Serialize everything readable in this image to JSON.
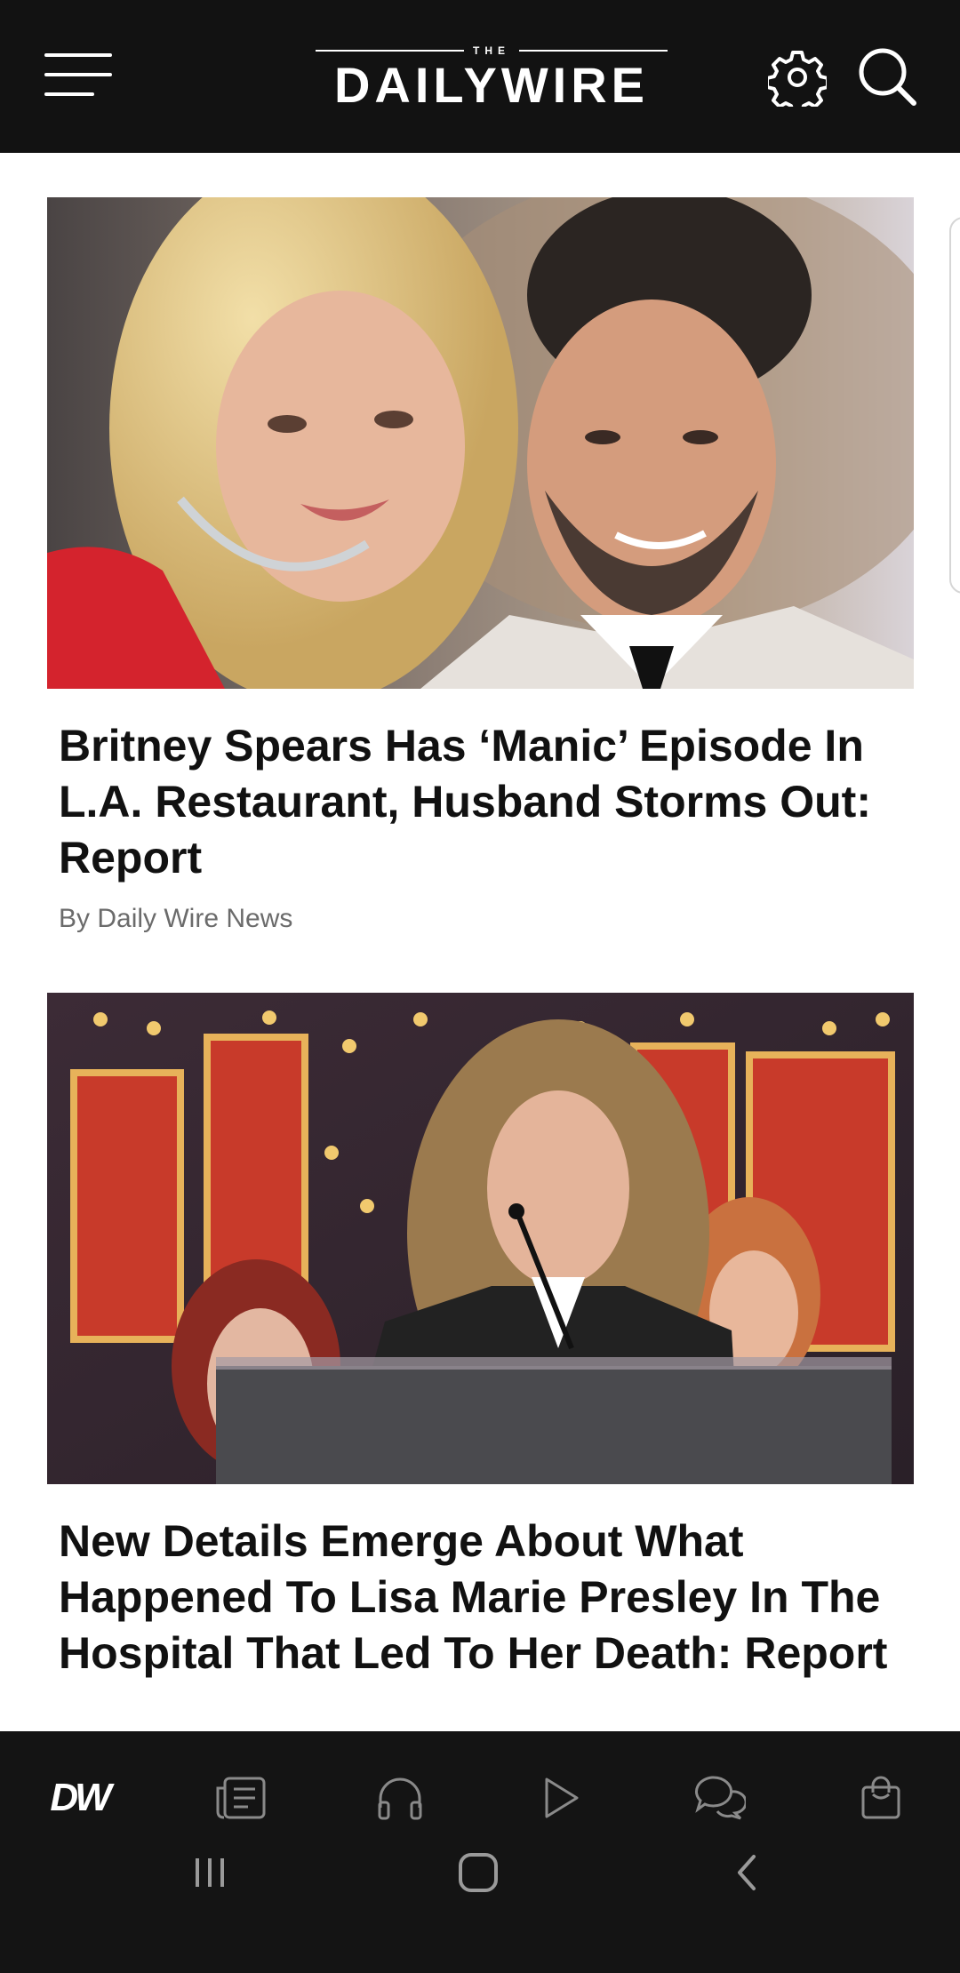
{
  "header": {
    "logo_small": "THE",
    "logo_main": "DAILYWIRE",
    "icons": [
      "menu-icon",
      "gear-icon",
      "search-icon"
    ]
  },
  "articles": [
    {
      "title": "Britney Spears Has ‘Manic’ Episode In L.A. Restaurant, Husband Storms Out: Report",
      "author": "By Daily Wire News"
    },
    {
      "title": "New Details Emerge About What Happened To Lisa Marie Presley In The Hospital That Led To Her Death: Report"
    }
  ],
  "bottom_nav": {
    "logo_label": "DW",
    "icons": [
      "home-logo",
      "articles-icon",
      "headphones-icon",
      "play-icon",
      "chat-icon",
      "shop-bag-icon"
    ]
  },
  "system_nav": {
    "icons": [
      "recent-apps-icon",
      "home-icon",
      "back-icon"
    ]
  },
  "colors": {
    "header_bg": "#121212",
    "nav_bg": "#141414",
    "title_text": "#111111",
    "author_text": "#6b6b6b"
  }
}
